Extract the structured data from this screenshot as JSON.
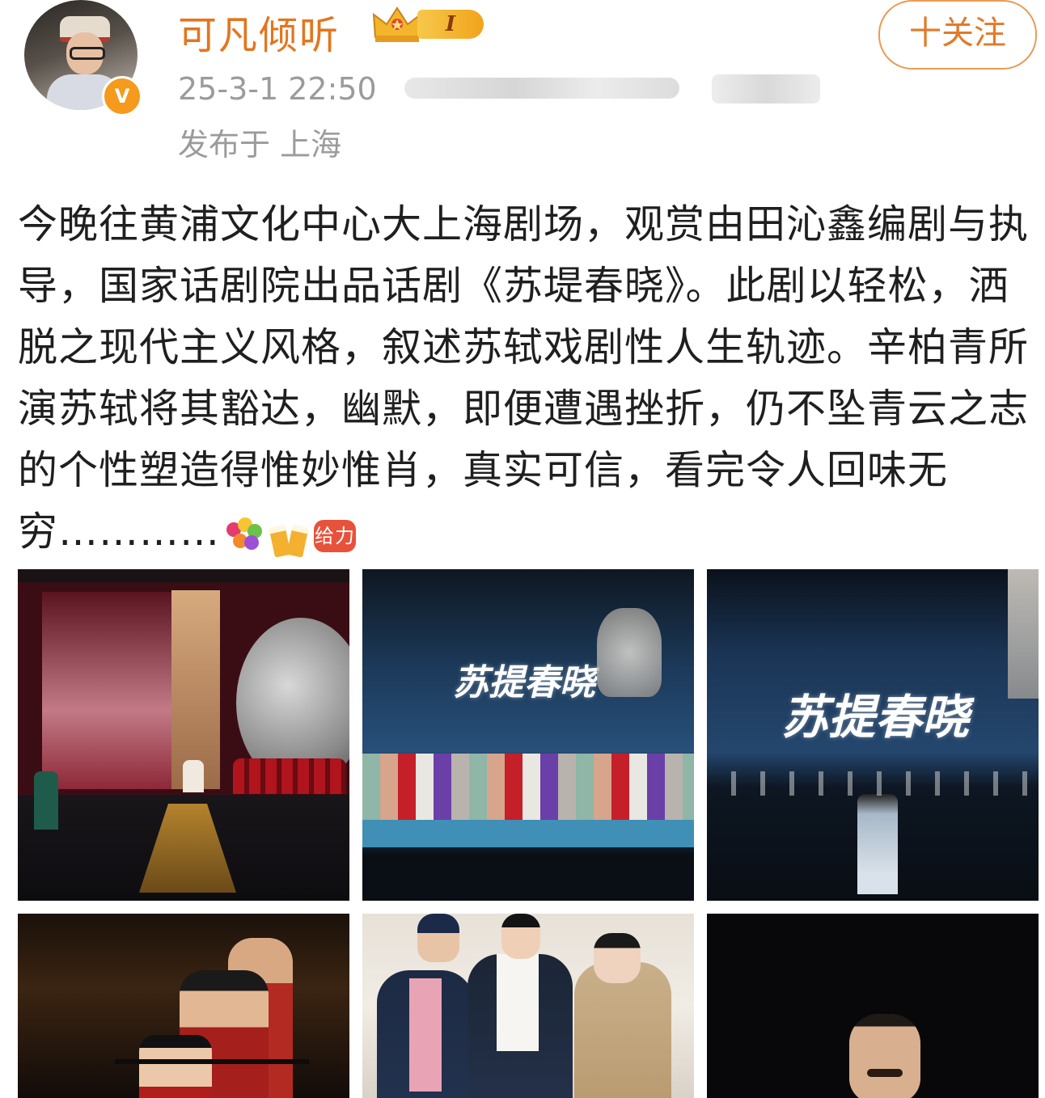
{
  "user": {
    "name": "可凡倾听",
    "level_badge": "I",
    "verified_mark": "V"
  },
  "post_meta": {
    "timestamp": "25-3-1 22:50",
    "location": "发布于 上海"
  },
  "actions": {
    "follow_label": "十关注"
  },
  "post": {
    "text": "今晚往黄浦文化中心大上海剧场，观赏由田沁鑫编剧与执导，国家话剧院出品话剧《苏堤春晓》。此剧以轻松，洒脱之现代主义风格，叙述苏轼戏剧性人生轨迹。辛柏青所演苏轼将其豁达，幽默，即便遭遇挫折，仍不坠青云之志的个性塑造得惟妙惟肖，真实可信，看完令人回味无穷…………",
    "emojis": [
      "flowers-icon",
      "beer-icon",
      "cheer-icon"
    ],
    "cheer_emoji_text": "给力"
  },
  "photos": {
    "title_calligraphy": "苏提春晓"
  },
  "colors": {
    "username": "#e3761e",
    "follow_border": "#e99b55",
    "meta_gray": "#9b9b9b",
    "verified": "#f59a1c"
  }
}
